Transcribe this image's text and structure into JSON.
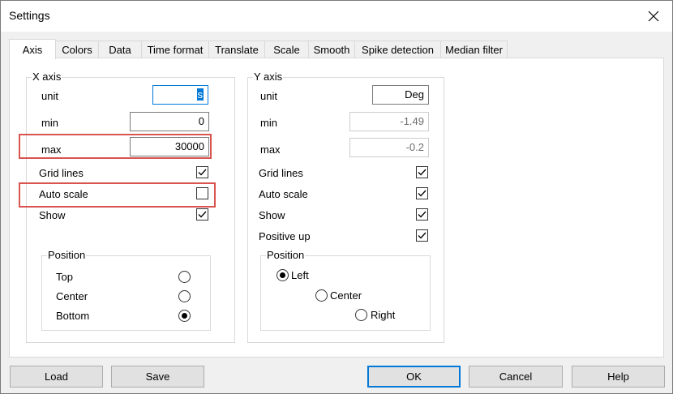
{
  "window": {
    "title": "Settings"
  },
  "tabs": [
    "Axis",
    "Colors",
    "Data",
    "Time format",
    "Translate",
    "Scale",
    "Smooth",
    "Spike detection",
    "Median filter"
  ],
  "x_axis": {
    "title": "X axis",
    "unit_label": "unit",
    "unit_value": "s",
    "min_label": "min",
    "min_value": "0",
    "max_label": "max",
    "max_value": "30000",
    "grid_label": "Grid lines",
    "grid_checked": true,
    "auto_label": "Auto scale",
    "auto_checked": false,
    "show_label": "Show",
    "show_checked": true,
    "position": {
      "title": "Position",
      "options": [
        "Top",
        "Center",
        "Bottom"
      ],
      "selected": "Bottom"
    }
  },
  "y_axis": {
    "title": "Y axis",
    "unit_label": "unit",
    "unit_value": "Deg",
    "min_label": "min",
    "min_value": "-1.49",
    "max_label": "max",
    "max_value": "-0.2",
    "grid_label": "Grid lines",
    "grid_checked": true,
    "auto_label": "Auto scale",
    "auto_checked": true,
    "show_label": "Show",
    "show_checked": true,
    "positive_label": "Positive up",
    "positive_checked": true,
    "position": {
      "title": "Position",
      "options": [
        "Left",
        "Center",
        "Right"
      ],
      "selected": "Left"
    }
  },
  "buttons": {
    "load": "Load",
    "save": "Save",
    "ok": "OK",
    "cancel": "Cancel",
    "help": "Help"
  },
  "icons": {
    "close": "close-icon",
    "check": "checkmark-icon"
  },
  "colors": {
    "highlight": "#d9534f",
    "focus": "#0078d7"
  }
}
